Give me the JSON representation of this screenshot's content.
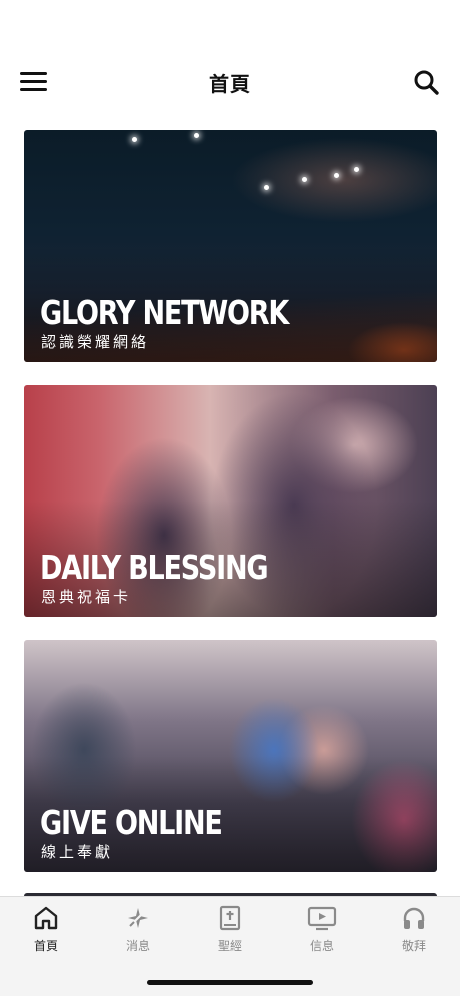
{
  "header": {
    "title": "首頁",
    "menu_icon": "hamburger-menu-icon",
    "search_icon": "search-icon"
  },
  "cards": [
    {
      "title": "GLORY NETWORK",
      "subtitle": "認識榮耀網絡"
    },
    {
      "title": "DAILY BLESSING",
      "subtitle": "恩典祝福卡"
    },
    {
      "title": "GIVE ONLINE",
      "subtitle": "線上奉獻"
    }
  ],
  "tabbar": {
    "active_color": "#222222",
    "inactive_color": "#8a8a8a",
    "items": [
      {
        "label": "首頁",
        "icon": "home-icon",
        "active": true
      },
      {
        "label": "消息",
        "icon": "sparkle-icon",
        "active": false
      },
      {
        "label": "聖經",
        "icon": "bible-icon",
        "active": false
      },
      {
        "label": "信息",
        "icon": "tv-play-icon",
        "active": false
      },
      {
        "label": "敬拜",
        "icon": "headphones-icon",
        "active": false
      }
    ]
  }
}
